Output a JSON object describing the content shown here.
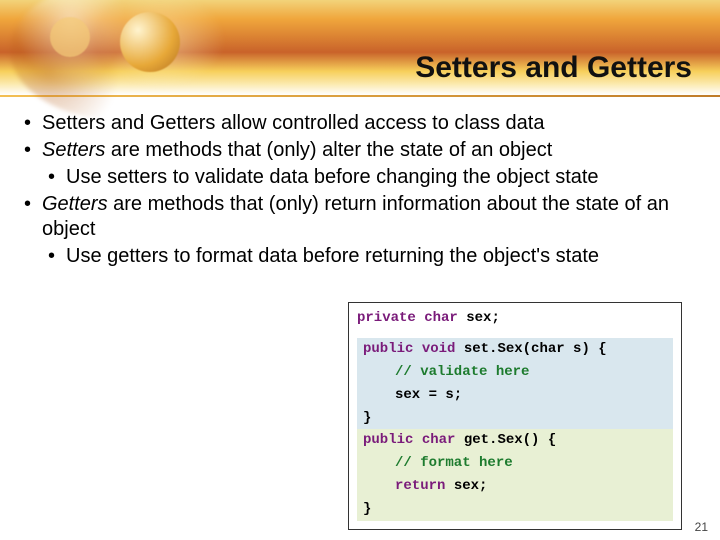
{
  "title": "Setters and Getters",
  "bullets": {
    "b1": "Setters and Getters allow controlled access to class data",
    "b2_a": "Setters",
    "b2_b": " are methods that (only) alter the state of an object",
    "b2_sub": "Use setters to validate data before changing the object state",
    "b3_a": "Getters",
    "b3_b": " are methods that (only) return information about the state of an object",
    "b3_sub": "Use getters to format data before returning the object's state"
  },
  "code": {
    "kw_private": "private",
    "kw_char": "char",
    "kw_public": "public",
    "kw_void": "void",
    "kw_return": "return",
    "field": " sex;",
    "setter_sig": " set.Sex(char s) {",
    "cm_validate": "// validate here",
    "setter_body": "sex = s;",
    "close": "}",
    "getter_sig": " get.Sex() {",
    "cm_format": "// format here",
    "getter_ret": " sex;"
  },
  "page_number": "21"
}
